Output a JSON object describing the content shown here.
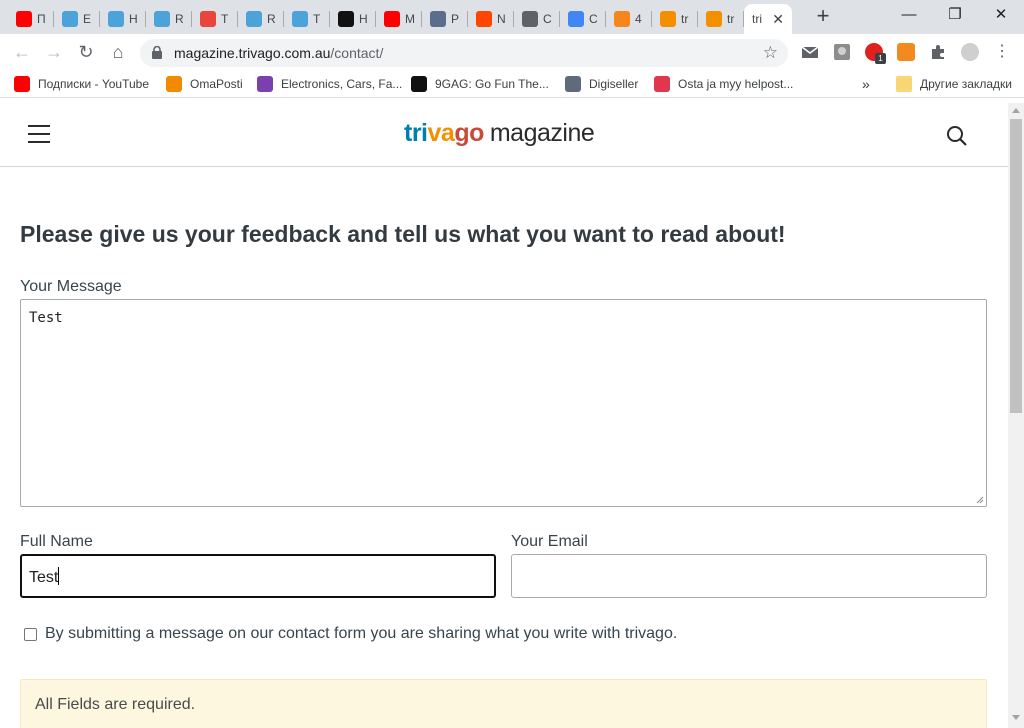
{
  "browser": {
    "tabs": [
      {
        "title": "П",
        "icon": "youtube-icon",
        "color": "#ff0000"
      },
      {
        "title": "E",
        "icon": "diamond-icon",
        "color": "#4ba3d9"
      },
      {
        "title": "H",
        "icon": "diamond-icon",
        "color": "#4ba3d9"
      },
      {
        "title": "R",
        "icon": "diamond-icon",
        "color": "#4ba3d9"
      },
      {
        "title": "T",
        "icon": "wave-icon",
        "color": "#e8453c"
      },
      {
        "title": "R",
        "icon": "diamond-icon",
        "color": "#4ba3d9"
      },
      {
        "title": "T",
        "icon": "diamond-icon",
        "color": "#4ba3d9"
      },
      {
        "title": "H",
        "icon": "k-icon",
        "color": "#111111"
      },
      {
        "title": "M",
        "icon": "youtube-icon",
        "color": "#ff0000"
      },
      {
        "title": "P",
        "icon": "horse-icon",
        "color": "#5a6e8c"
      },
      {
        "title": "N",
        "icon": "reddit-icon",
        "color": "#ff4500"
      },
      {
        "title": "C",
        "icon": "globe-icon",
        "color": "#5f6368"
      },
      {
        "title": "C",
        "icon": "docs-icon",
        "color": "#4285f4"
      },
      {
        "title": "4",
        "icon": "fox-icon",
        "color": "#f6851b"
      },
      {
        "title": "tr",
        "icon": "trivago-icon",
        "color": "#f48f00"
      },
      {
        "title": "tr",
        "icon": "trivago-icon",
        "color": "#f48f00"
      },
      {
        "title": "tri",
        "icon": "",
        "color": ""
      }
    ],
    "active_tab_index": 16,
    "new_tab_label": "+",
    "window_controls": {
      "minimize": "—",
      "restore": "❐",
      "close": "✕"
    },
    "nav": {
      "back": "←",
      "forward": "→",
      "reload": "↻",
      "home": "⌂"
    },
    "url_host": "magazine.trivago.com.au",
    "url_path": "/contact/",
    "extension_badge": "1",
    "bookmarks": [
      {
        "label": "Подписки - YouTube",
        "icon": "youtube-icon",
        "color": "#ff0000"
      },
      {
        "label": "OmaPosti",
        "icon": "posti-icon",
        "color": "#f28a00"
      },
      {
        "label": "Electronics, Cars, Fa...",
        "icon": "ebay-bag-icon",
        "color": "#7b3fb0"
      },
      {
        "label": "9GAG: Go Fun The...",
        "icon": "9gag-icon",
        "color": "#111111"
      },
      {
        "label": "Digiseller",
        "icon": "bag-icon",
        "color": "#5f6b7a"
      },
      {
        "label": "Osta ja myy helpost...",
        "icon": "tori-icon",
        "color": "#e0364f"
      }
    ],
    "bookmarks_overflow": "»",
    "other_bookmarks": "Другие закладки"
  },
  "site": {
    "logo": {
      "part1": "tri",
      "part2": "va",
      "part3": "go",
      "part4": "magazine"
    },
    "title": "Please give us your feedback and tell us what you want to read about!",
    "message_label": "Your Message",
    "message_value": "Test",
    "name_label": "Full Name",
    "name_value": "Test",
    "email_label": "Your Email",
    "email_value": "",
    "consent_text": "By submitting a message on our contact form you are sharing what you write with trivago.",
    "notice_text": "All Fields are required."
  }
}
